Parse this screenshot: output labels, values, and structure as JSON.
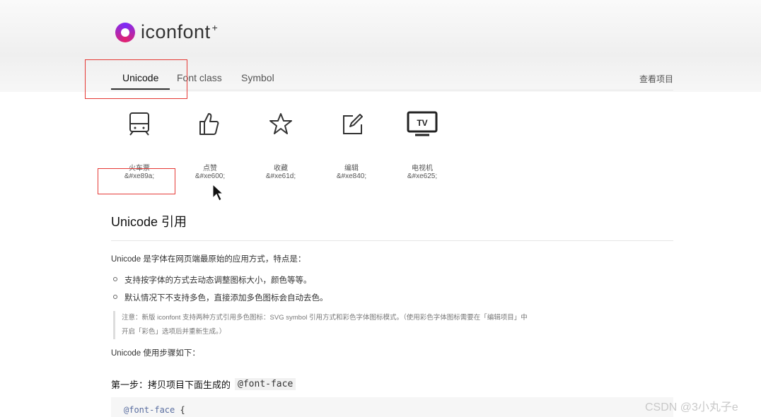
{
  "brand": {
    "name": "iconfont",
    "suffix": "+"
  },
  "tabs": [
    {
      "label": "Unicode",
      "active": true
    },
    {
      "label": "Font class",
      "active": false
    },
    {
      "label": "Symbol",
      "active": false
    }
  ],
  "view_project": "查看项目",
  "icons": [
    {
      "name": "火车票",
      "code": "&#xe89a;",
      "icon": "train-ticket-icon"
    },
    {
      "name": "点赞",
      "code": "&#xe600;",
      "icon": "thumbs-up-icon"
    },
    {
      "name": "收藏",
      "code": "&#xe61d;",
      "icon": "star-icon"
    },
    {
      "name": "编辑",
      "code": "&#xe840;",
      "icon": "edit-icon"
    },
    {
      "name": "电视机",
      "code": "&#xe625;",
      "icon": "tv-icon"
    }
  ],
  "tv_label": "TV",
  "section": {
    "title": "Unicode 引用",
    "intro": "Unicode 是字体在网页端最原始的应用方式，特点是：",
    "bullets": [
      "支持按字体的方式去动态调整图标大小，颜色等等。",
      "默认情况下不支持多色，直接添加多色图标会自动去色。"
    ],
    "note_line1": "注意：新版 iconfont 支持两种方式引用多色图标：SVG symbol 引用方式和彩色字体图标模式。（使用彩色字体图标需要在「编辑项目」中",
    "note_line2": "开启「彩色」选项后并重新生成。）",
    "steps_intro": "Unicode 使用步骤如下：",
    "step1_label": "第一步：拷贝项目下面生成的",
    "step1_code": "@font-face",
    "code_line": "@font-face",
    "code_brace": "{"
  },
  "watermark": "CSDN @3小丸子e",
  "colors": {
    "highlight_box": "#e53935",
    "logo_gradient_start": "#7b2bf9",
    "logo_gradient_end": "#e2226f"
  }
}
